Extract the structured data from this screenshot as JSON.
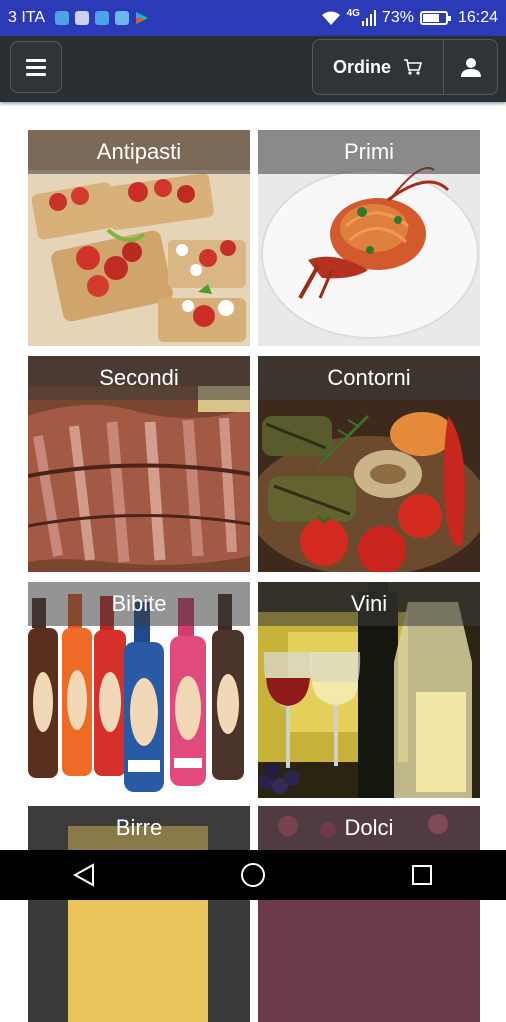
{
  "status_bar": {
    "carrier": "3 ITA",
    "network": "4G",
    "battery": "73%",
    "battery_level": 0.73,
    "time": "16:24",
    "icons": [
      "shield-icon",
      "image-icon",
      "message-icon",
      "shield-icon",
      "play-store-icon",
      "wifi-icon",
      "signal-icon",
      "battery-icon"
    ]
  },
  "app_bar": {
    "menu_icon": "hamburger-menu-icon",
    "order_label": "Ordine",
    "cart_icon": "cart-icon",
    "user_icon": "user-icon"
  },
  "categories": [
    {
      "title": "Antipasti"
    },
    {
      "title": "Primi"
    },
    {
      "title": "Secondi"
    },
    {
      "title": "Contorni"
    },
    {
      "title": "Bibite"
    },
    {
      "title": "Vini"
    },
    {
      "title": "Birre"
    },
    {
      "title": "Dolci"
    }
  ],
  "nav_bar": {
    "icons": [
      "back-icon",
      "home-icon",
      "recents-icon"
    ]
  }
}
